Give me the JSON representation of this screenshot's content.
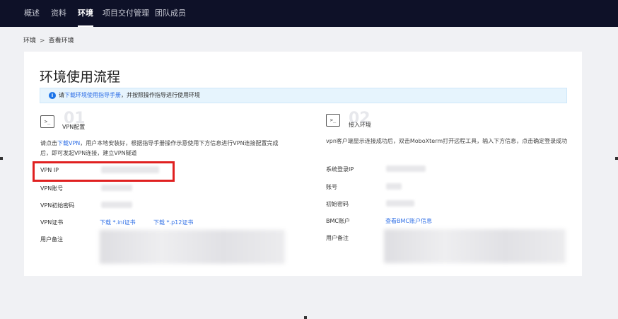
{
  "nav": {
    "items": [
      {
        "label": "概述"
      },
      {
        "label": "资料"
      },
      {
        "label": "环境"
      },
      {
        "label": "项目交付管理"
      },
      {
        "label": "团队成员"
      }
    ]
  },
  "breadcrumb": {
    "root": "环境",
    "separator": ">",
    "current": "查看环境"
  },
  "page": {
    "title": "环境使用流程"
  },
  "notice": {
    "prefix": "请",
    "link": "下载环境使用指导手册",
    "suffix": "，并按照操作指导进行使用环境"
  },
  "step1": {
    "icon": "terminal-icon",
    "icon_glyph": ">_",
    "number": "01",
    "title": "VPN配置",
    "desc_prefix": "请点击",
    "desc_link": "下载VPN",
    "desc_suffix": "，用户本地安装好，根据指导手册操作示意使用下方信息进行VPN连接配置完成后，即可发起VPN连接，建立VPN隧道",
    "fields": {
      "vpn_ip": "VPN IP",
      "vpn_account": "VPN账号",
      "vpn_password": "VPN初始密码",
      "vpn_cert": "VPN证书",
      "user_note": "用户备注"
    },
    "cert_ini": "下载 *.ini证书",
    "cert_p12": "下载 *.p12证书"
  },
  "step2": {
    "icon": "terminal-icon",
    "icon_glyph": ">_",
    "number": "02",
    "title": "接入环境",
    "desc": "vpn客户端显示连接成功后，双击MoboXterm打开远程工具，输入下方信息，点击确定登录成功",
    "fields": {
      "login_ip": "系统登录IP",
      "account": "账号",
      "password": "初始密码",
      "bmc": "BMC账户",
      "user_note": "用户备注"
    },
    "bmc_link": "查看BMC账户信息"
  },
  "colors": {
    "nav_bg": "#0e1128",
    "link": "#2f6fe6",
    "highlight": "#e02020",
    "notice_bg": "#e6f4fd"
  }
}
